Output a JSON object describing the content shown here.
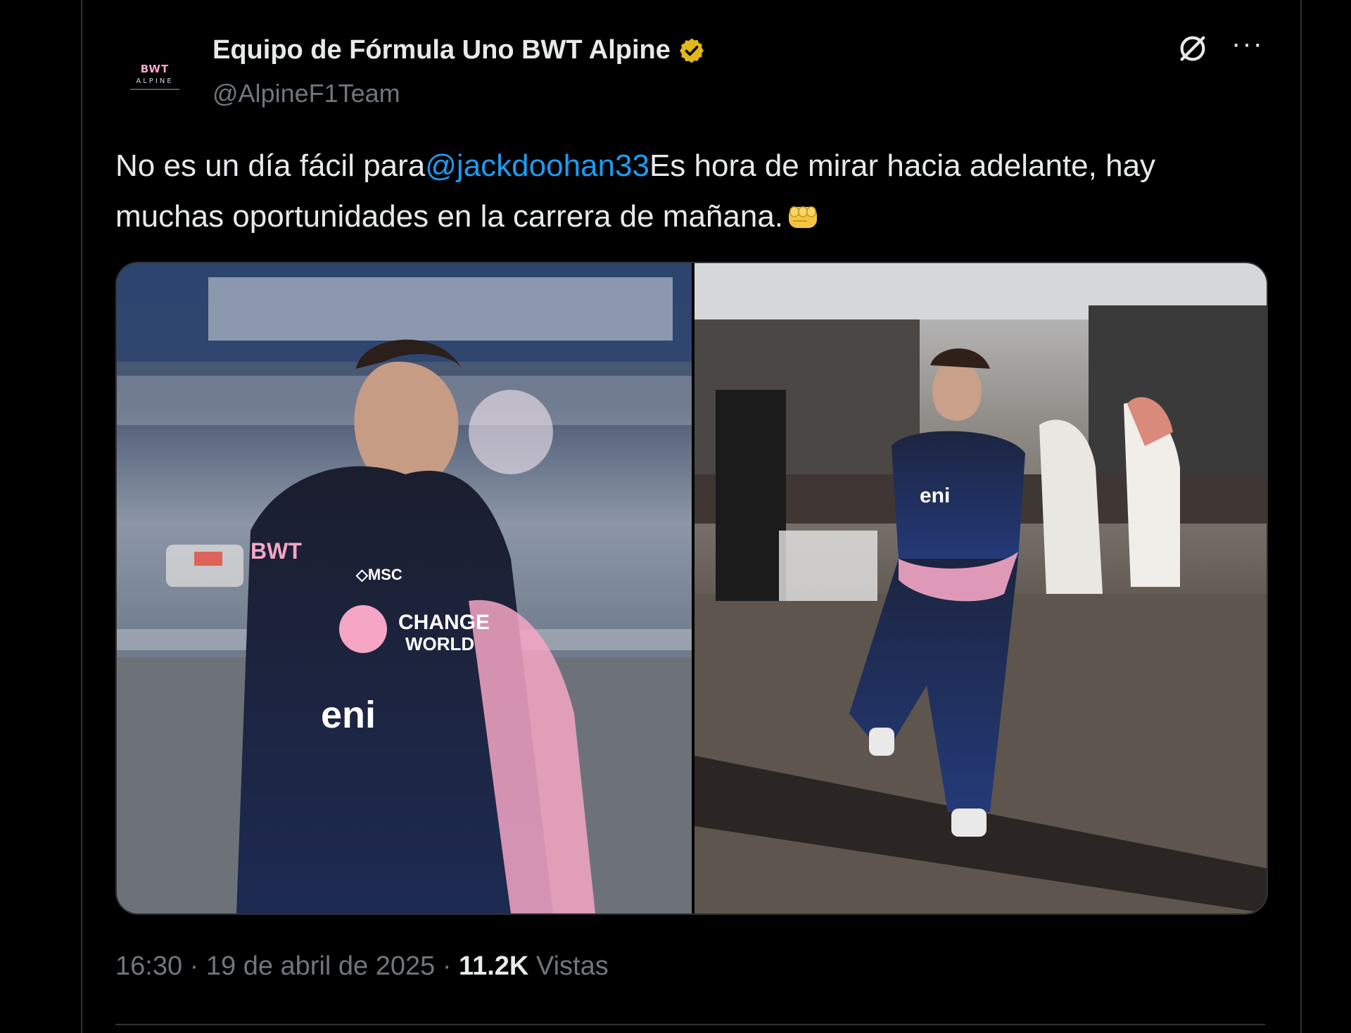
{
  "tweet": {
    "author": {
      "display_name": "Equipo de Fórmula Uno BWT Alpine",
      "handle": "@AlpineF1Team",
      "verified_badge": "gold-verified-badge",
      "avatar_logo": {
        "line1": "BWT",
        "line2": "ALPINE"
      }
    },
    "text": {
      "before_mention": "No es un día fácil para",
      "mention": "@jackdoohan33",
      "after_mention": "Es hora de mirar hacia adelante, hay muchas oportunidades en la carrera de mañana."
    },
    "emoji": "oncoming-fist",
    "media": [
      {
        "description_icon": "photo"
      },
      {
        "description_icon": "photo"
      }
    ],
    "meta": {
      "time": "16:30",
      "separator": "·",
      "date": "19 de abril de 2025",
      "views_count": "11.2K",
      "views_label": "Vistas"
    },
    "actions": {
      "grok_icon": "grok-icon",
      "more_icon": "more-icon"
    }
  },
  "colors": {
    "background": "#000000",
    "text_primary": "#e7e9ea",
    "text_secondary": "#71767b",
    "mention": "#1d9bf0",
    "border": "#2f3336",
    "verified_gold": "#e2b719",
    "brand_pink": "#f4a6c4"
  }
}
